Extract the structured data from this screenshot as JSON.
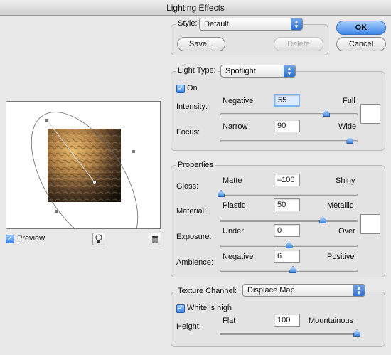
{
  "window": {
    "title": "Lighting Effects"
  },
  "style": {
    "label": "Style:",
    "value": "Default",
    "save_label": "Save...",
    "delete_label": "Delete"
  },
  "buttons": {
    "ok": "OK",
    "cancel": "Cancel"
  },
  "light": {
    "type_label": "Light Type:",
    "type_value": "Spotlight",
    "on_label": "On",
    "on_checked": true,
    "intensity": {
      "label": "Intensity:",
      "min": "Negative",
      "max": "Full",
      "value": "55",
      "level": 55,
      "range": [
        -100,
        100
      ]
    },
    "focus": {
      "label": "Focus:",
      "min": "Narrow",
      "max": "Wide",
      "value": "90",
      "level": 90,
      "range": [
        -100,
        100
      ]
    },
    "color": "#ffffff"
  },
  "properties": {
    "title": "Properties",
    "gloss": {
      "label": "Gloss:",
      "min": "Matte",
      "max": "Shiny",
      "value": "–100",
      "level": -100,
      "range": [
        -100,
        100
      ]
    },
    "material": {
      "label": "Material:",
      "min": "Plastic",
      "max": "Metallic",
      "value": "50",
      "level": 50,
      "range": [
        -100,
        100
      ]
    },
    "exposure": {
      "label": "Exposure:",
      "min": "Under",
      "max": "Over",
      "value": "0",
      "level": 0,
      "range": [
        -100,
        100
      ]
    },
    "ambience": {
      "label": "Ambience:",
      "min": "Negative",
      "max": "Positive",
      "value": "6",
      "level": 6,
      "range": [
        -100,
        100
      ]
    },
    "color": "#ffffff"
  },
  "texture": {
    "channel_label": "Texture Channel:",
    "channel_value": "Displace Map",
    "white_high_label": "White is high",
    "white_high_checked": true,
    "height": {
      "label": "Height:",
      "min": "Flat",
      "max": "Mountainous",
      "value": "100",
      "level": 100,
      "range": [
        0,
        100
      ]
    }
  },
  "preview": {
    "label": "Preview",
    "checked": true,
    "bulb_icon": "lightbulb-icon",
    "trash_icon": "trash-icon"
  }
}
